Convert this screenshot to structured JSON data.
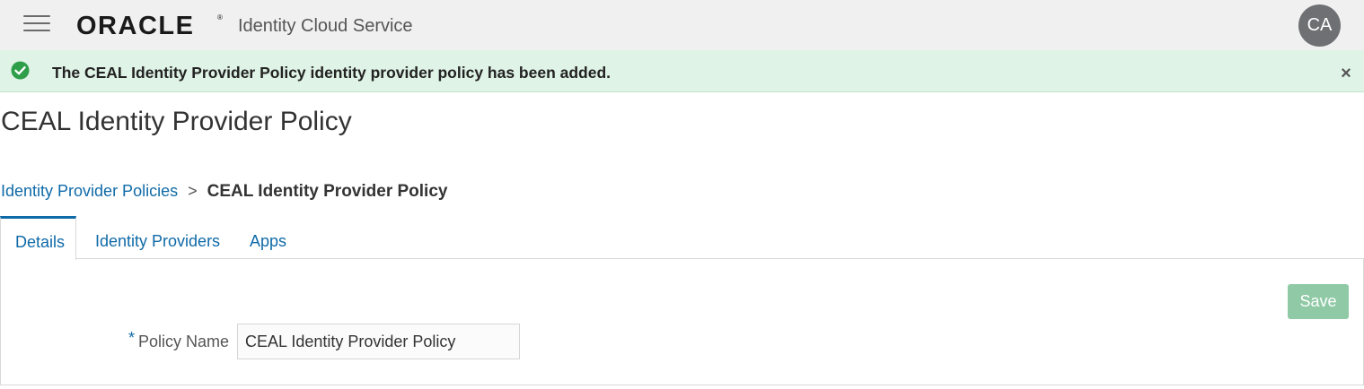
{
  "header": {
    "logo_text": "ORACLE",
    "product_name": "Identity Cloud Service",
    "avatar_initials": "CA"
  },
  "banner": {
    "message": "The CEAL Identity Provider Policy identity provider policy has been added.",
    "close_label": "×",
    "status": "success",
    "status_color": "#2e9e4a"
  },
  "page": {
    "title": "CEAL Identity Provider Policy"
  },
  "breadcrumb": {
    "parent": "Identity Provider Policies",
    "separator": ">",
    "current": "CEAL Identity Provider Policy"
  },
  "tabs": [
    {
      "label": "Details",
      "active": true
    },
    {
      "label": "Identity Providers",
      "active": false
    },
    {
      "label": "Apps",
      "active": false
    }
  ],
  "form": {
    "save_label": "Save",
    "required_marker": "*",
    "policy_name_label": "Policy Name",
    "policy_name_value": "CEAL Identity Provider Policy"
  },
  "colors": {
    "accent": "#0f6aa8",
    "save_button": "#8fc9a5",
    "banner_background": "#dff3e6",
    "header_background": "#f0f0f0"
  },
  "icons": {
    "menu": "hamburger-menu-icon",
    "success": "check-circle-icon",
    "close": "close-icon"
  }
}
